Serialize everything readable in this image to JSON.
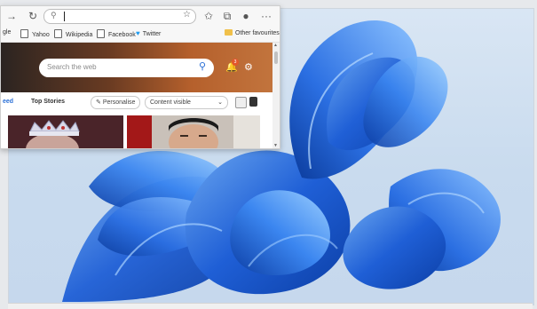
{
  "toolbar": {
    "back_icon": "arrow-right-icon",
    "refresh_icon": "refresh-icon",
    "address_value": ""
  },
  "bookmarks": {
    "items": [
      {
        "label": "gle",
        "icon": "page-icon"
      },
      {
        "label": "Yahoo",
        "icon": "page-icon"
      },
      {
        "label": "Wikipedia",
        "icon": "page-icon"
      },
      {
        "label": "Facebook",
        "icon": "page-icon"
      },
      {
        "label": "Twitter",
        "icon": "twitter-icon"
      }
    ],
    "other_favourites": "Other favourites"
  },
  "newtab": {
    "search_placeholder": "Search the web",
    "notification_count": "3",
    "tabs": [
      "eed",
      "Top Stories"
    ],
    "personalise_label": "Personalise",
    "content_select_value": "Content visible"
  },
  "colors": {
    "accent": "#2a6fd6",
    "wallpaper_blue": "#1f5fd6"
  }
}
